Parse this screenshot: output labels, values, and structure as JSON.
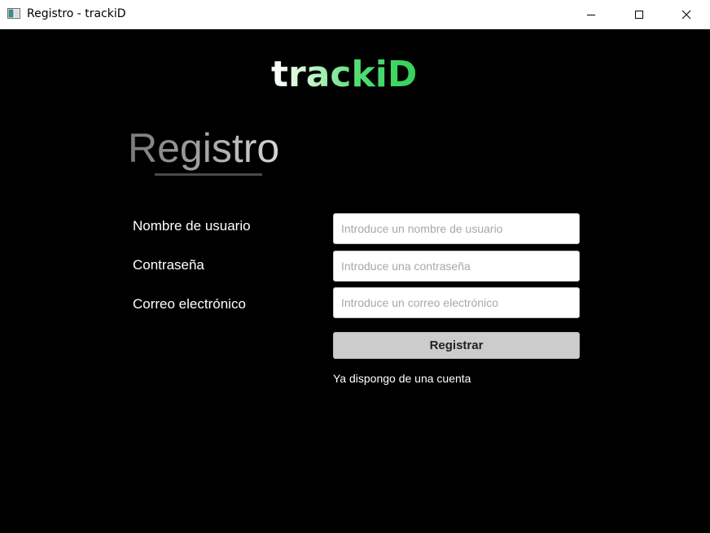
{
  "window": {
    "title": "Registro - trackiD",
    "controls": [
      "minimize-icon",
      "maximize-icon",
      "close-icon"
    ]
  },
  "brand": {
    "logo_text": "trackiD",
    "colors": {
      "logo_gradient_start": "#ffffff",
      "logo_gradient_end": "#35d05a",
      "heading_gradient_start": "#7a7a7a",
      "heading_gradient_end": "#d6d6d6",
      "background": "#000000",
      "button_bg": "#cccccc"
    }
  },
  "page": {
    "heading": "Registro"
  },
  "form": {
    "username": {
      "label": "Nombre de usuario",
      "placeholder": "Introduce un nombre de usuario",
      "value": ""
    },
    "password": {
      "label": "Contraseña",
      "placeholder": "Introduce una contraseña",
      "value": ""
    },
    "email": {
      "label": "Correo electrónico",
      "placeholder": "Introduce un correo electrónico",
      "value": ""
    },
    "submit_label": "Registrar",
    "login_link": "Ya dispongo de una cuenta"
  }
}
